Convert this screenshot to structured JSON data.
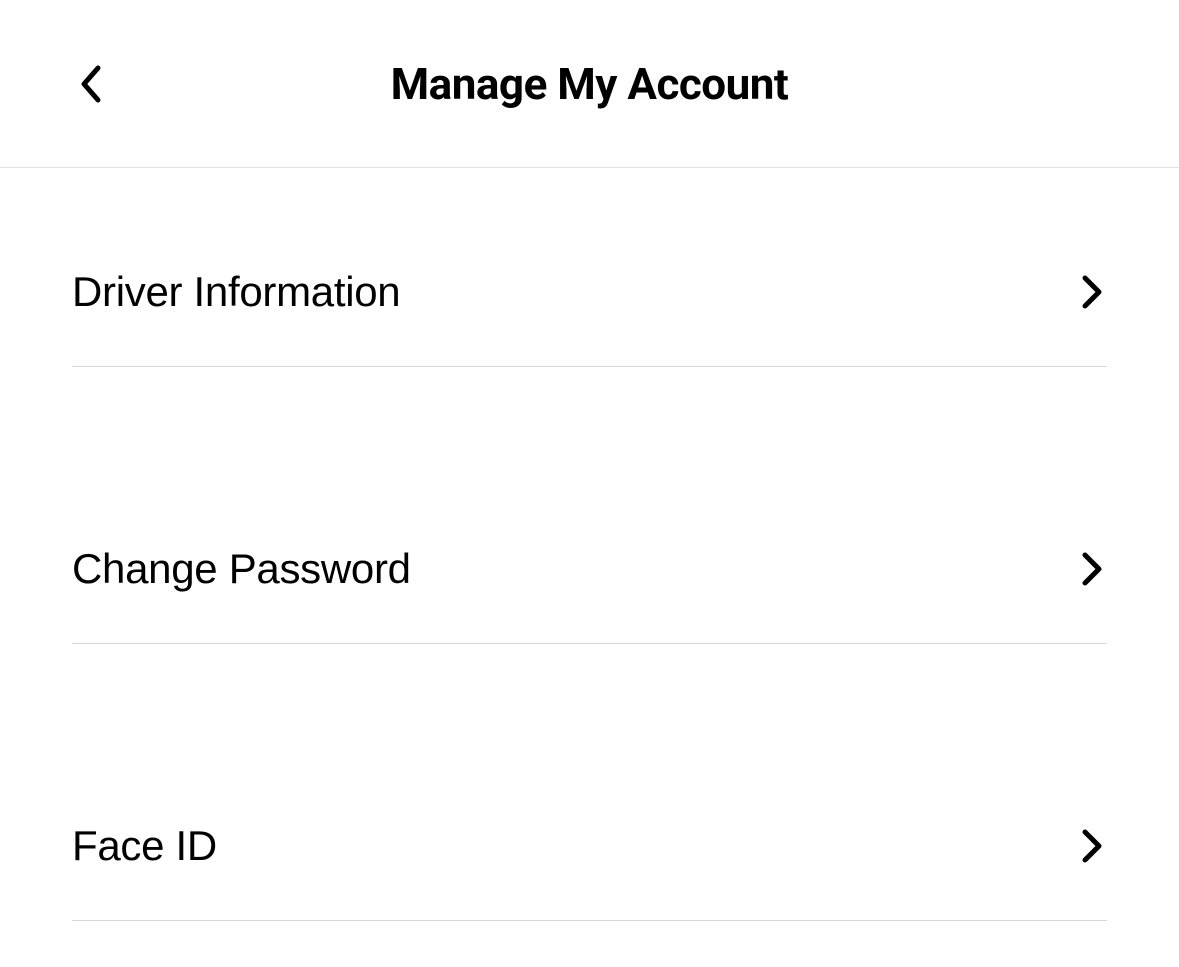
{
  "header": {
    "title": "Manage My Account"
  },
  "menu": {
    "items": [
      {
        "label": "Driver Information"
      },
      {
        "label": "Change Password"
      },
      {
        "label": "Face ID"
      }
    ]
  }
}
